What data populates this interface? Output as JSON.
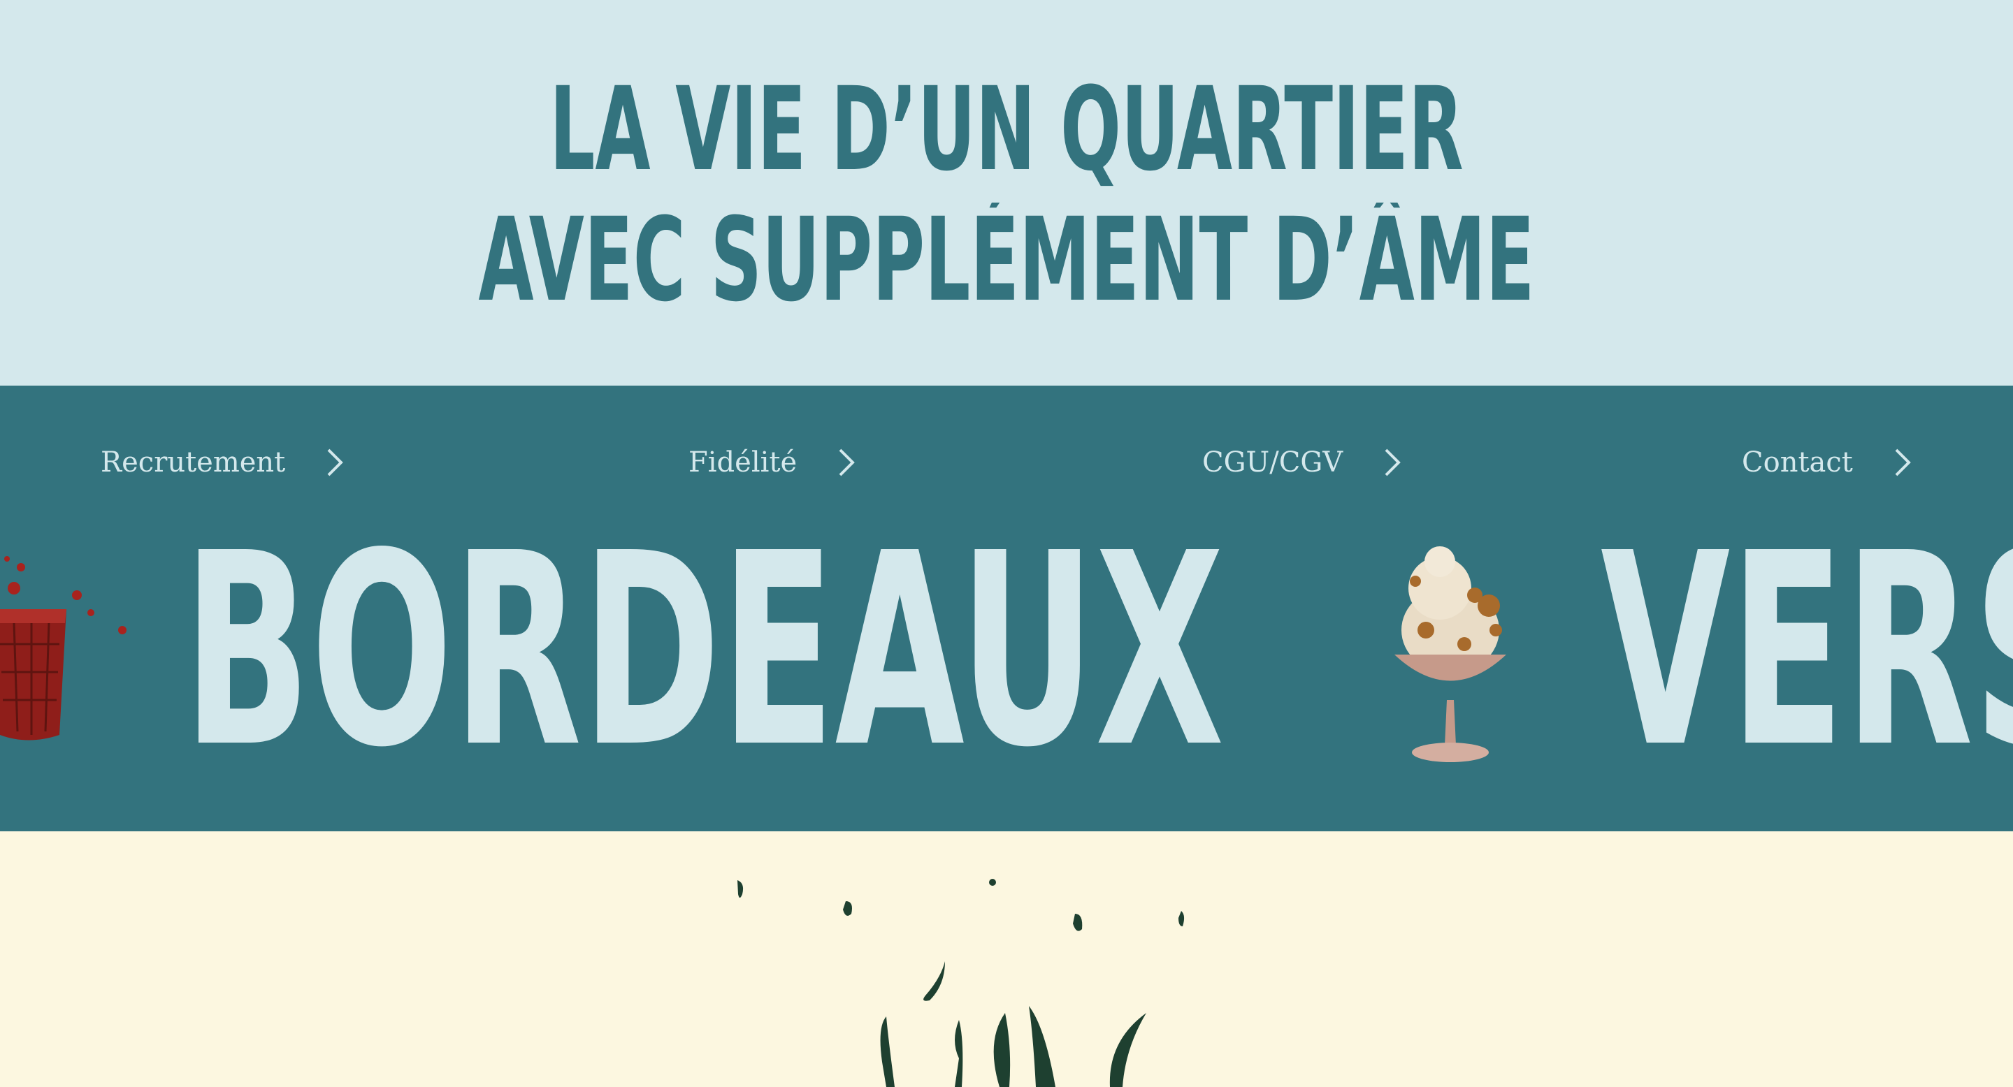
{
  "hero": {
    "line1": "LA VIE D’UN QUARTIER",
    "line2": "AVEC SUPPLÉMENT D’ÂME"
  },
  "nav": {
    "items": [
      {
        "label": "Recrutement",
        "icon": "chevron-right-icon"
      },
      {
        "label": "Fidélité",
        "icon": "chevron-right-icon"
      },
      {
        "label": "CGU/CGV",
        "icon": "chevron-right-icon"
      },
      {
        "label": "Contact",
        "icon": "chevron-right-icon"
      }
    ]
  },
  "marquee": {
    "words": [
      "BORDEAUX",
      "VERS"
    ],
    "images": [
      "red-cocktail-glass-illustration",
      "ice-cream-sundae-illustration"
    ]
  },
  "footer": {
    "illustration": "dark-green-plant-sprout-illustration"
  },
  "colors": {
    "hero_bg": "#d4e8ec",
    "brand_teal": "#33737e",
    "cream_bg": "#fcf7e0",
    "plant_green": "#1e4030"
  }
}
